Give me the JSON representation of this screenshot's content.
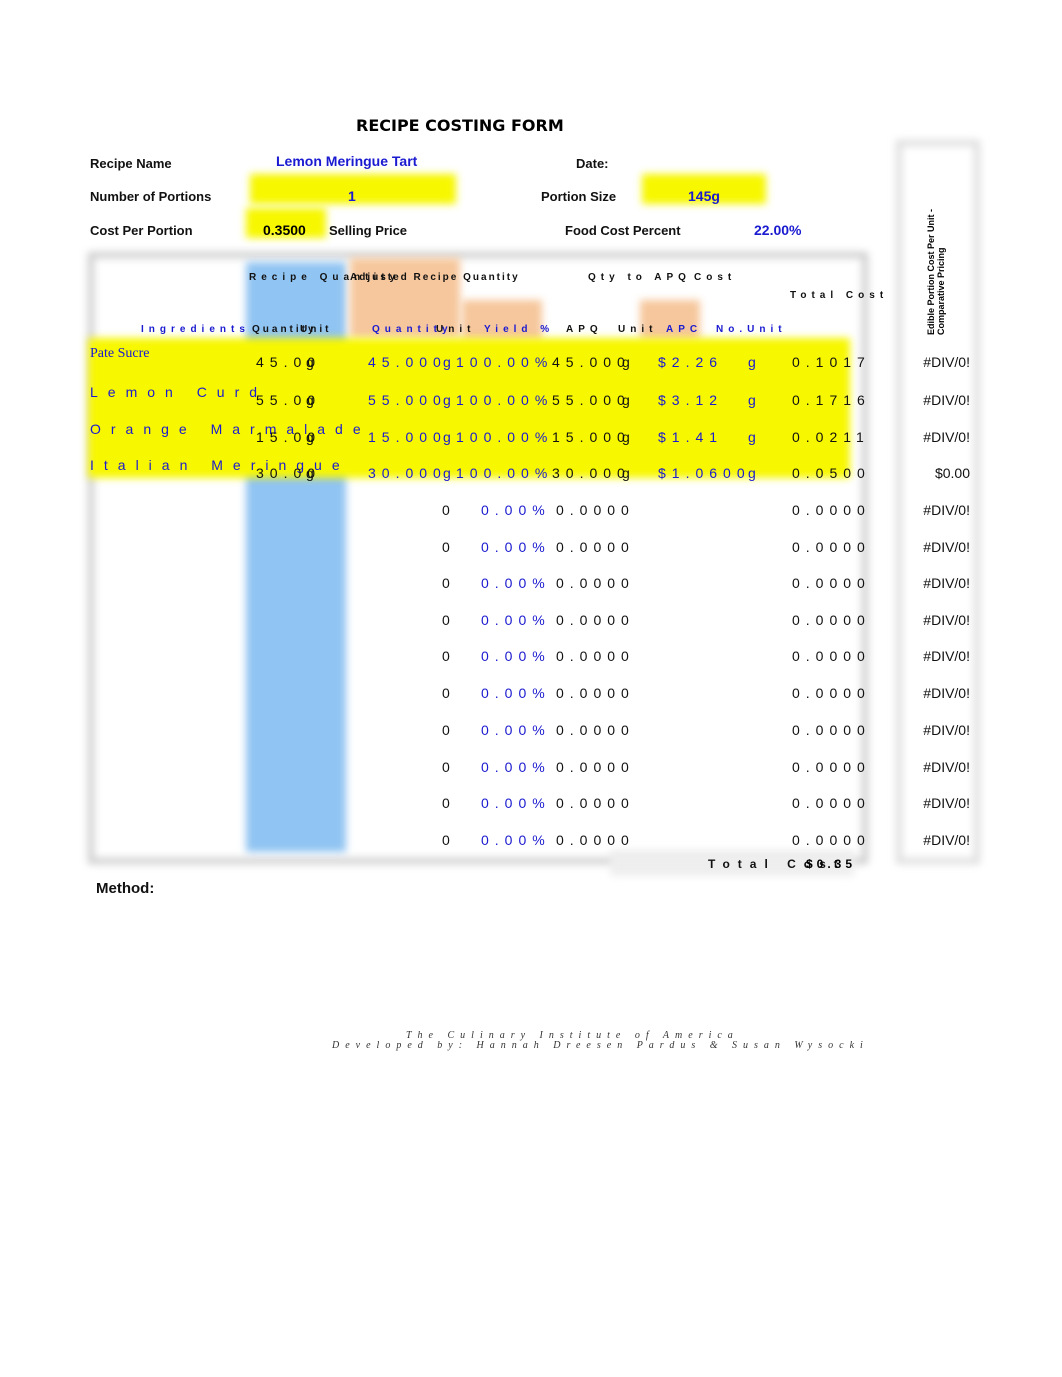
{
  "title": "RECIPE COSTING FORM",
  "header": {
    "recipe_name_label": "Recipe Name",
    "recipe_name": "Lemon Meringue Tart",
    "date_label": "Date:",
    "portions_label": "Number of Portions",
    "portions": "1",
    "portion_size_label": "Portion Size",
    "portion_size": "145g",
    "cost_per_portion_label": "Cost Per Portion",
    "cost_per_portion": "0.3500",
    "selling_price_label": "Selling Price",
    "food_cost_label": "Food Cost Percent",
    "food_cost": "22.00%"
  },
  "columns": {
    "recipe_quantity": "Recipe Quantity",
    "adjusted": "Adjusted Recipe Quantity",
    "apq": "Qty to APQ",
    "cost": "Cost",
    "total_cost": "Total Cost",
    "ingredients": "Ingredients",
    "quantity": "Quantity",
    "unit": "Unit",
    "quantity2": "Quantity",
    "unit2": "Unit",
    "yield": "Yield %",
    "apq_col": "APQ",
    "unit3": "Unit",
    "apc": "APC",
    "no_unit": "No.Unit",
    "ep_cost": "Edible Portion Cost Per Unit - Comparative Pricing"
  },
  "rows": [
    {
      "ingredient": "Pate Sucre",
      "qty": "45.00",
      "unit": "g",
      "adj_qty": "45.000",
      "adj_unit": "g",
      "yield": "100.00%",
      "apq": "45.000",
      "apq_unit": "g",
      "apc": "$2.26",
      "apc_unit": "g",
      "total": "0.1017",
      "ep": "#DIV/0!"
    },
    {
      "ingredient": "Lemon Curd",
      "qty": "55.00",
      "unit": "g",
      "adj_qty": "55.000",
      "adj_unit": "g",
      "yield": "100.00%",
      "apq": "55.000",
      "apq_unit": "g",
      "apc": "$3.12",
      "apc_unit": "g",
      "total": "0.1716",
      "ep": "#DIV/0!"
    },
    {
      "ingredient": "Orange Marmalade",
      "qty": "15.00",
      "unit": "g",
      "adj_qty": "15.000",
      "adj_unit": "g",
      "yield": "100.00%",
      "apq": "15.000",
      "apq_unit": "g",
      "apc": "$1.41",
      "apc_unit": "g",
      "total": "0.0211",
      "ep": "#DIV/0!"
    },
    {
      "ingredient": "Italian Meringue",
      "qty": "30.00",
      "unit": "g",
      "adj_qty": "30.000",
      "adj_unit": "g",
      "yield": "100.00%",
      "apq": "30.000",
      "apq_unit": "g",
      "apc": "$1.0600",
      "apc_unit": "g",
      "total": "0.0500",
      "ep": "$0.00"
    },
    {
      "adj_qty": "0",
      "yield": "0.00%",
      "apq": "0.0000",
      "total": "0.0000",
      "ep": "#DIV/0!"
    },
    {
      "adj_qty": "0",
      "yield": "0.00%",
      "apq": "0.0000",
      "total": "0.0000",
      "ep": "#DIV/0!"
    },
    {
      "adj_qty": "0",
      "yield": "0.00%",
      "apq": "0.0000",
      "total": "0.0000",
      "ep": "#DIV/0!"
    },
    {
      "adj_qty": "0",
      "yield": "0.00%",
      "apq": "0.0000",
      "total": "0.0000",
      "ep": "#DIV/0!"
    },
    {
      "adj_qty": "0",
      "yield": "0.00%",
      "apq": "0.0000",
      "total": "0.0000",
      "ep": "#DIV/0!"
    },
    {
      "adj_qty": "0",
      "yield": "0.00%",
      "apq": "0.0000",
      "total": "0.0000",
      "ep": "#DIV/0!"
    },
    {
      "adj_qty": "0",
      "yield": "0.00%",
      "apq": "0.0000",
      "total": "0.0000",
      "ep": "#DIV/0!"
    },
    {
      "adj_qty": "0",
      "yield": "0.00%",
      "apq": "0.0000",
      "total": "0.0000",
      "ep": "#DIV/0!"
    },
    {
      "adj_qty": "0",
      "yield": "0.00%",
      "apq": "0.0000",
      "total": "0.0000",
      "ep": "#DIV/0!"
    },
    {
      "adj_qty": "0",
      "yield": "0.00%",
      "apq": "0.0000",
      "total": "0.0000",
      "ep": "#DIV/0!"
    }
  ],
  "total_cost_label": "Total Cost",
  "total_cost": "$0.35",
  "method_label": "Method:",
  "footer": {
    "line1": "The Culinary Institute of America",
    "line2": "Developed by: Hannah Dreesen Pardus & Susan Wysocki"
  },
  "colors": {
    "highlight": "#f7f700",
    "blue_col": "#90c4f2",
    "orange_col": "#f6c79c",
    "value_text": "#1a1ad0"
  }
}
